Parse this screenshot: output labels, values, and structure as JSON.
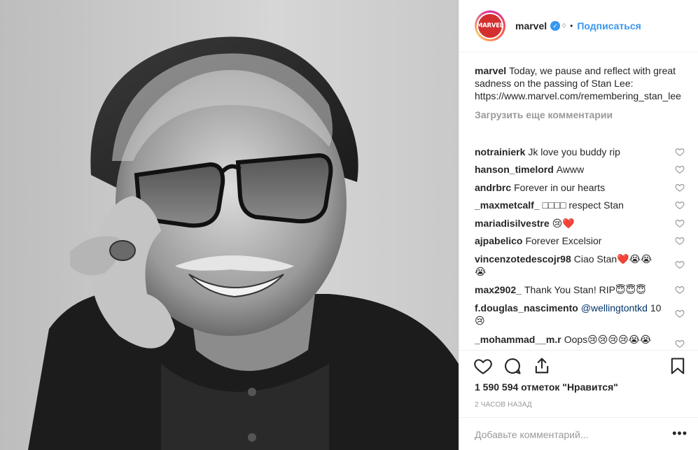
{
  "header": {
    "username": "marvel",
    "avatar_text": "MARVEL",
    "follow_label": "Подписаться",
    "separator": "•"
  },
  "caption": {
    "username": "marvel",
    "text": "Today, we pause and reflect with great sadness on the passing of Stan Lee: https://www.marvel.com/remembering_stan_lee"
  },
  "load_more_label": "Загрузить еще комментарии",
  "comments": [
    {
      "user": "notrainierk",
      "text": "Jk love you buddy rip"
    },
    {
      "user": "hanson_timelord",
      "text": "Awww"
    },
    {
      "user": "andrbrc",
      "text": "Forever in our hearts"
    },
    {
      "user": "_maxmetcalf_",
      "text": "□□□□ respect Stan"
    },
    {
      "user": "mariadisilvestre",
      "text": "😢❤️"
    },
    {
      "user": "ajpabelico",
      "text": "Forever Excelsior"
    },
    {
      "user": "vincenzotedescojr98",
      "text": "Ciao Stan❤️😭😭 😭"
    },
    {
      "user": "max2902_",
      "text": "Thank You Stan! RIP😇😇😇"
    },
    {
      "user": "f.douglas_nascimento",
      "mention": "@wellingtontkd",
      "text": "10 😢"
    },
    {
      "user": "_mohammad__m.r",
      "text": "Oops😢😢😢😢😭😭"
    }
  ],
  "icons": {
    "like": "heart-icon",
    "comment": "comment-bubble-icon",
    "share": "share-icon",
    "save": "bookmark-icon"
  },
  "likes_text": "1 590 594 отметок \"Нравится\"",
  "time_text": "2 ЧАСОВ НАЗАД",
  "add_comment_placeholder": "Добавьте комментарий...",
  "more_label": "•••",
  "colors": {
    "link": "#3897f0",
    "verified": "#3897f0",
    "muted": "#999999",
    "text": "#262626",
    "brand_red": "#d32f2f"
  }
}
